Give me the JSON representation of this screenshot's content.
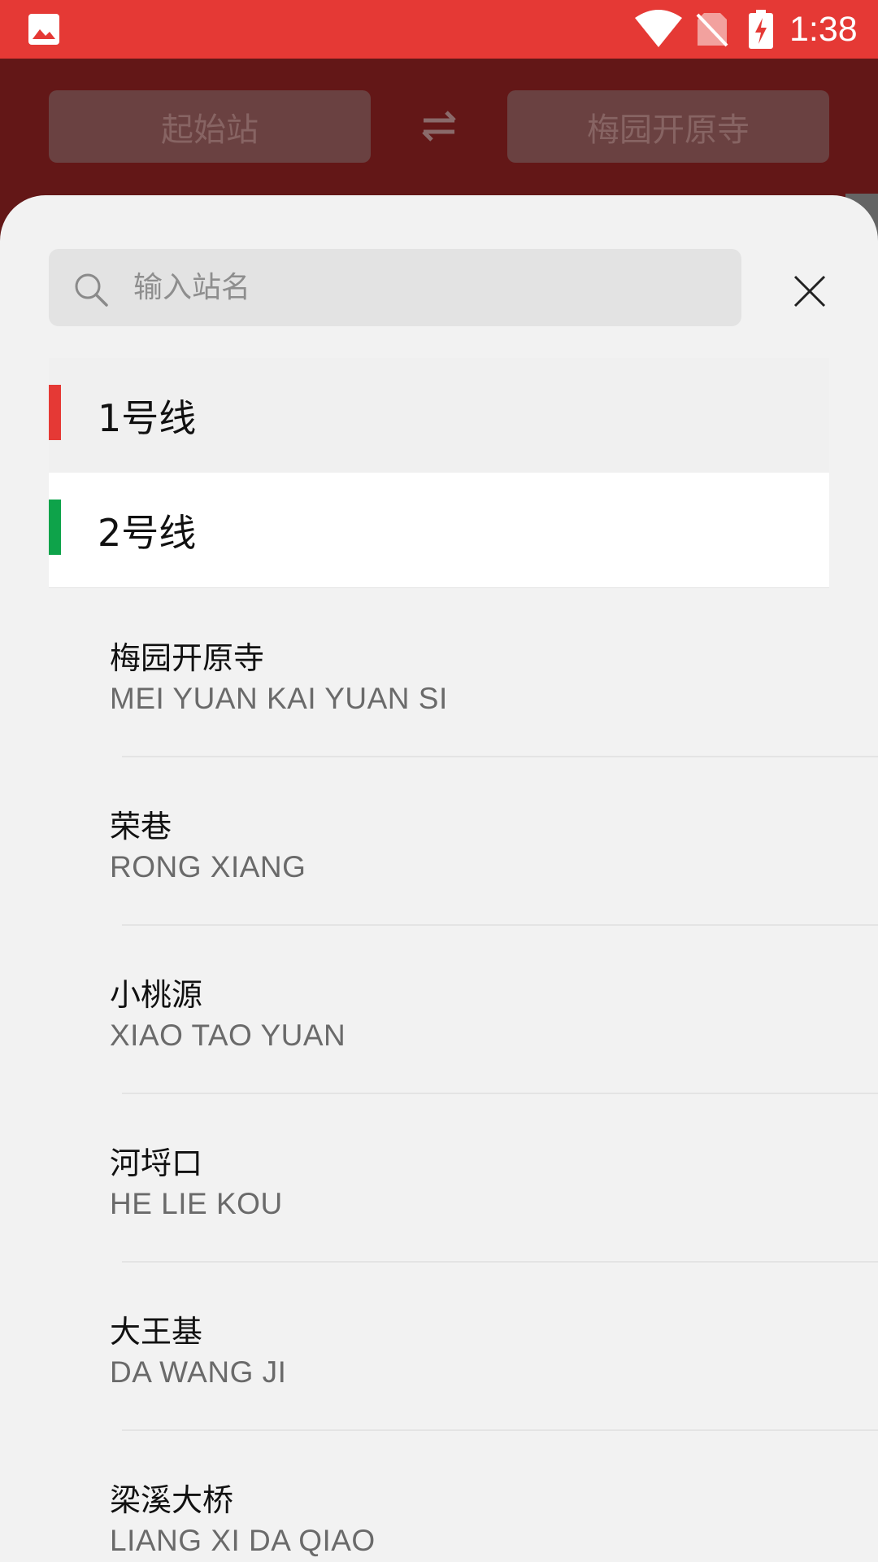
{
  "status_bar": {
    "time": "1:38",
    "icons": [
      "gallery-icon",
      "wifi-icon",
      "no-sim-icon",
      "battery-charging-icon"
    ],
    "background_color": "#E53935"
  },
  "header": {
    "from_station": "起始站",
    "to_station": "梅园开原寺",
    "swap_icon": "swap-arrows-icon"
  },
  "search": {
    "placeholder": "输入站名",
    "value": ""
  },
  "lines": [
    {
      "label": "1号线",
      "color": "#E53935"
    },
    {
      "label": "2号线",
      "color": "#0EA34A"
    }
  ],
  "stations": [
    {
      "name": "梅园开原寺",
      "pinyin": "MEI YUAN KAI YUAN SI"
    },
    {
      "name": "荣巷",
      "pinyin": "RONG XIANG"
    },
    {
      "name": "小桃源",
      "pinyin": "XIAO TAO YUAN"
    },
    {
      "name": "河埒口",
      "pinyin": "HE LIE KOU"
    },
    {
      "name": "大王基",
      "pinyin": "DA WANG JI"
    },
    {
      "name": "梁溪大桥",
      "pinyin": "LIANG XI DA QIAO"
    }
  ]
}
